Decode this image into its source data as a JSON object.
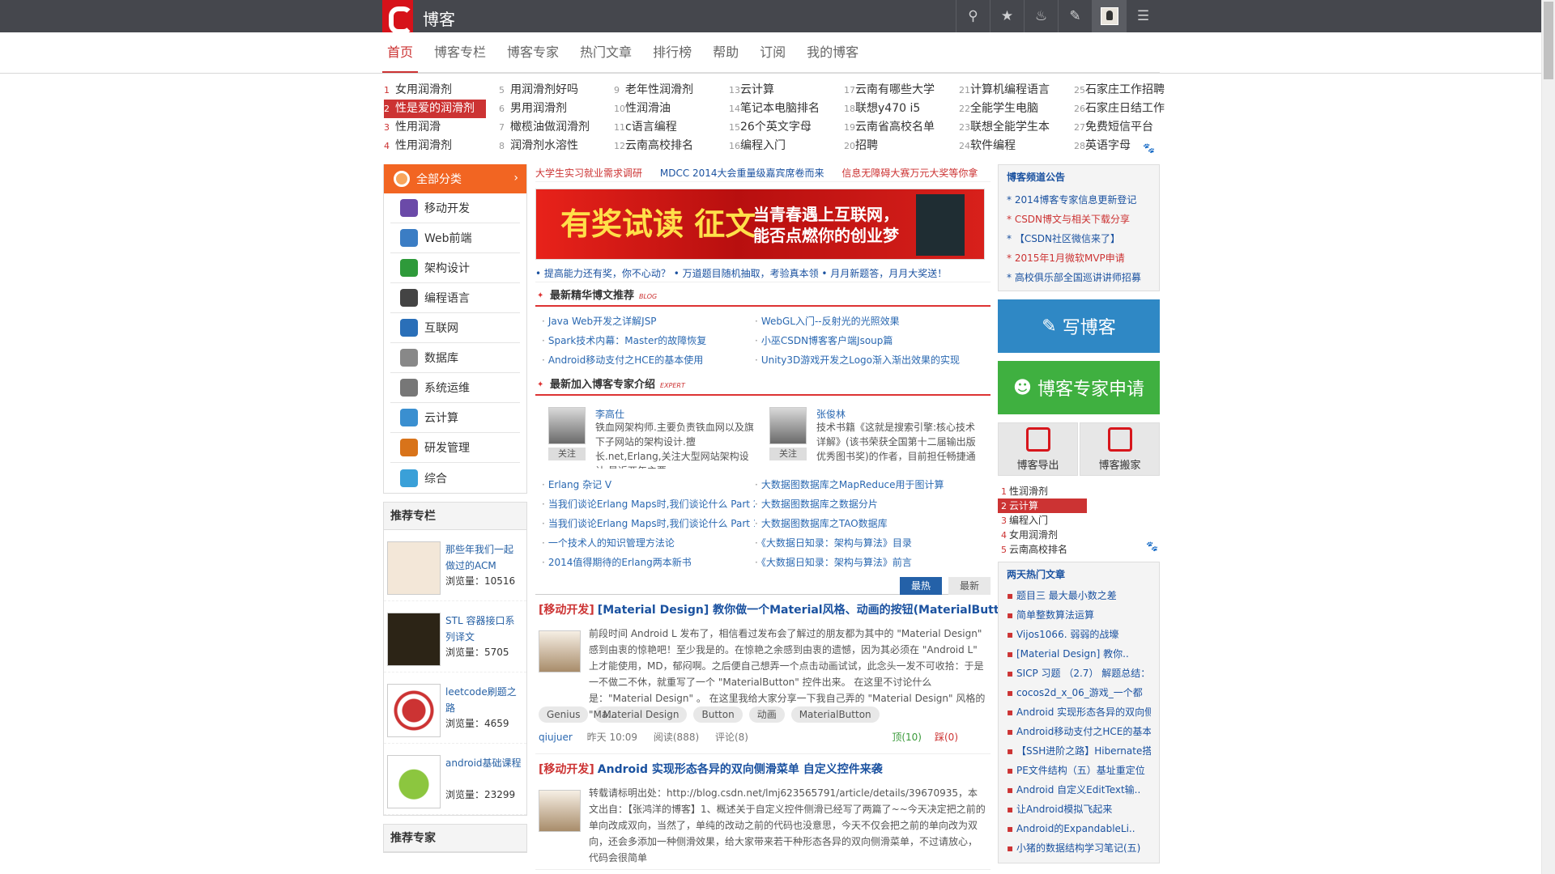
{
  "header": {
    "site_title": "博客",
    "icons": [
      "search-icon",
      "star-icon",
      "bell-icon",
      "edit-icon",
      "avatar",
      "menu-icon"
    ]
  },
  "nav": [
    "首页",
    "博客专栏",
    "博客专家",
    "热门文章",
    "排行榜",
    "帮助",
    "订阅",
    "我的博客"
  ],
  "hotwords": [
    [
      [
        "1",
        "女用润滑剂"
      ],
      [
        "2",
        "性是爱的润滑剂"
      ],
      [
        "3",
        "性用润滑"
      ],
      [
        "4",
        "性用润滑剂"
      ]
    ],
    [
      [
        "5",
        "用润滑剂好吗"
      ],
      [
        "6",
        "男用润滑剂"
      ],
      [
        "7",
        "橄榄油做润滑剂"
      ],
      [
        "8",
        "润滑剂水溶性"
      ]
    ],
    [
      [
        "9",
        "老年性润滑剂"
      ],
      [
        "10",
        "性润滑油"
      ],
      [
        "11",
        "c语言编程"
      ],
      [
        "12",
        "云南高校排名"
      ]
    ],
    [
      [
        "13",
        "云计算"
      ],
      [
        "14",
        "笔记本电脑排名"
      ],
      [
        "15",
        "26个英文字母"
      ],
      [
        "16",
        "编程入门"
      ]
    ],
    [
      [
        "17",
        "云南有哪些大学"
      ],
      [
        "18",
        "联想y470 i5"
      ],
      [
        "19",
        "云南省高校名单"
      ],
      [
        "20",
        "招聘"
      ]
    ],
    [
      [
        "21",
        "计算机编程语言"
      ],
      [
        "22",
        "全能学生电脑"
      ],
      [
        "23",
        "联想全能学生本"
      ],
      [
        "24",
        "软件编程"
      ]
    ],
    [
      [
        "25",
        "石家庄工作招聘"
      ],
      [
        "26",
        "石家庄日结工作"
      ],
      [
        "27",
        "免费短信平台"
      ],
      [
        "28",
        "英语字母"
      ]
    ]
  ],
  "categories": {
    "head": "全部分类",
    "items": [
      "移动开发",
      "Web前端",
      "架构设计",
      "编程语言",
      "互联网",
      "数据库",
      "系统运维",
      "云计算",
      "研发管理",
      "综合"
    ]
  },
  "columns": {
    "title": "推荐专栏",
    "items": [
      {
        "title": "那些年我们一起做过的ACM",
        "views": "浏览量：10516"
      },
      {
        "title": "STL 容器接口系列译文",
        "views": "浏览量：5705"
      },
      {
        "title": "leetcode刷题之路",
        "views": "浏览量：4659"
      },
      {
        "title": "android基础课程",
        "views": "浏览量：23299"
      }
    ]
  },
  "experts_title": "推荐专家",
  "promo": {
    "links": [
      "大学生实习就业需求调研",
      "MDCC 2014大会重量级嘉宾席卷而来",
      "信息无障碍大赛万元大奖等你拿"
    ],
    "banner_big": "有奖试读 征文",
    "banner_slogan_1": "当青春遇上互联网，",
    "banner_slogan_2": "能否点燃你的创业梦",
    "tagline": "• 提高能力还有奖，你不心动？ • 万道题目随机抽取，考验真本领 • 月月新题答，月月大奖送！"
  },
  "featured": {
    "title": "最新精华博文推荐",
    "badge": "BLOG",
    "items": [
      "Java Web开发之详解JSP",
      "WebGL入门--反射光的光照效果",
      "Spark技术内幕：Master的故障恢复",
      "小巫CSDN博客客户端Jsoup篇",
      "Android移动支付之HCE的基本使用",
      "Unity3D游戏开发之Logo渐入渐出效果的实现"
    ]
  },
  "new_experts": {
    "title": "最新加入博客专家介绍",
    "badge": "EXPERT",
    "follow": "关注",
    "people": [
      {
        "name": "李高仕",
        "desc": "铁血网架构师.主要负责铁血网以及旗下子网站的架构设计.擅长.net,Erlang,关注大型网站架构设计.最近两年主要"
      },
      {
        "name": "张俊林",
        "desc": "技术书籍《这就是搜索引擎:核心技术详解》(该书荣获全国第十二届输出版优秀图书奖)的作者，目前担任畅捷通"
      }
    ],
    "articles": [
      "Erlang 杂记 V",
      "大数据图数据库之MapReduce用于图计算",
      "当我们谈论Erlang Maps时,我们谈论什么 Part 2",
      "大数据图数据库之数据分片",
      "当我们谈论Erlang Maps时,我们谈论什么 Part 1",
      "大数据图数据库之TAO数据库",
      "一个技术人的知识管理方法论",
      "《大数据日知录：架构与算法》目录",
      "2014值得期待的Erlang两本新书",
      "《大数据日知录：架构与算法》前言"
    ]
  },
  "feed_tabs": [
    "最热",
    "最新"
  ],
  "posts": [
    {
      "cat": "[移动开发]",
      "title": "[Material Design] 教你做一个Material风格、动画的按钮(MaterialButton)",
      "summary": "前段时间 Android L 发布了，相信看过发布会了解过的朋友都为其中的 \"Material Design\" 感到由衷的惊艳吧！至少我是的。在惊艳之余感到由衷的遗憾，因为其必须在 \"Android L\" 上才能使用，MD，郁闷啊。之后便自己想弄一个点击动画试试，此念头一发不可收拾：于是一不做二不休，就重写了一个 \"MaterialButton\" 控件出来。 在这里不讨论什么是：\"Material Design\" 。 在这里我给大家分享一下我自己弄的 \"Material Design\" 风格的 \"Ma...",
      "tags": [
        "Genius",
        "Material Design",
        "Button",
        "动画",
        "MaterialButton"
      ],
      "author": "qiujuer",
      "time": "昨天 10:09",
      "reads": "阅读(888)",
      "comments": "评论(8)",
      "up": "顶(10)",
      "down": "踩(0)"
    },
    {
      "cat": "[移动开发]",
      "title": "Android 实现形态各异的双向侧滑菜单 自定义控件来袭",
      "summary": "转载请标明出处：http://blog.csdn.net/lmj623565791/article/details/39670935，本文出自：【张鸿洋的博客】1、概述关于自定义控件侧滑已经写了两篇了~~今天决定把之前的单向改成双向，当然了，单纯的改动之前的代码也没意思，今天不仅会把之前的单向改为双向，还会多添加一种侧滑效果，给大家带来若干种形态各异的双向侧滑菜单，不过请放心，代码会很简单",
      "tags": [],
      "author": "",
      "time": "",
      "reads": "",
      "comments": "",
      "up": "",
      "down": ""
    }
  ],
  "notice": {
    "title": "博客频道公告",
    "items": [
      {
        "text": "* 2014博客专家信息更新登记",
        "color": "b"
      },
      {
        "text": "* CSDN博文与相关下载分享",
        "color": "r"
      },
      {
        "text": "* 【CSDN社区微信来了】",
        "color": "b"
      },
      {
        "text": "* 2015年1月微软MVP申请",
        "color": "r"
      },
      {
        "text": "* 高校俱乐部全国巡讲讲师招募",
        "color": "b"
      }
    ]
  },
  "buttons": {
    "write": "写博客",
    "apply": "博客专家申请",
    "export": "博客导出",
    "move": "博客搬家"
  },
  "rank": [
    [
      "1",
      "性润滑剂"
    ],
    [
      "2",
      "云计算"
    ],
    [
      "3",
      "编程入门"
    ],
    [
      "4",
      "女用润滑剂"
    ],
    [
      "5",
      "云南高校排名"
    ]
  ],
  "hot2": {
    "title": "两天热门文章",
    "items": [
      "题目三 最大最小数之差",
      "简单整数算法运算",
      "Vijos1066. 弱弱的战壕",
      "[Material Design] 教你..",
      "SICP 习题 （2.7） 解题总结：..",
      "cocos2d_x_06_游戏_一个都",
      "Android 实现形态各异的双向侧",
      "Android移动支付之HCE的基本",
      "【SSH进阶之路】Hibernate搭",
      "PE文件结构（五）基址重定位",
      "Android 自定义EditText输..",
      "让Android模拟飞起来",
      "Android的ExpandableLi..",
      "小猪的数据结构学习笔记(五)"
    ]
  },
  "colors": {
    "brand_red": "#d6121a",
    "top_bar": "#45474d",
    "accent_blue": "#2f88c5",
    "accent_green": "#3fb040"
  }
}
